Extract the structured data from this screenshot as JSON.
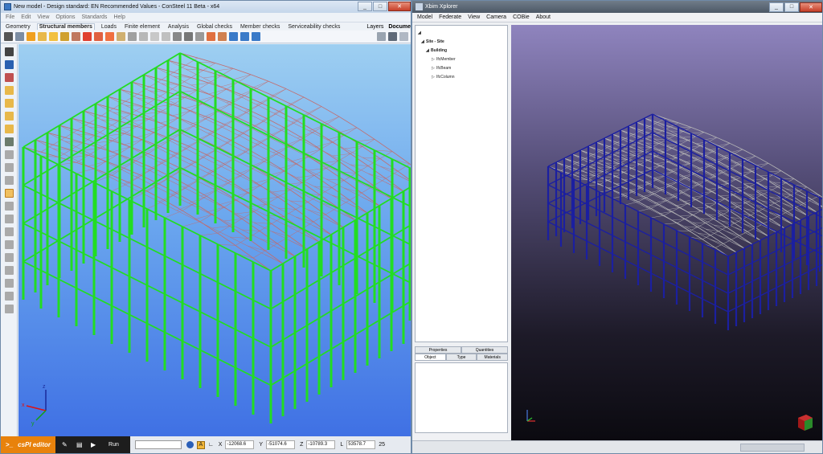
{
  "consteel": {
    "title": "New model - Design standard: EN Recommended Values - ConSteel 11 Beta - x64",
    "menu": [
      "File",
      "Edit",
      "View",
      "Options",
      "Standards",
      "Help"
    ],
    "tabs": [
      {
        "label": "Geometry",
        "active": false
      },
      {
        "label": "Structural members",
        "active": true
      },
      {
        "label": "Loads",
        "active": false
      },
      {
        "label": "Finite element",
        "active": false
      },
      {
        "label": "Analysis",
        "active": false
      },
      {
        "label": "Global checks",
        "active": false
      },
      {
        "label": "Member checks",
        "active": false
      },
      {
        "label": "Serviceability checks",
        "active": false
      }
    ],
    "right_tabs": [
      "Layers",
      "Docume"
    ],
    "statusbar": {
      "editor_label": "csPI editor",
      "run_label": "Run",
      "x_label": "X",
      "x_value": "-12068.6",
      "y_label": "Y",
      "y_value": "-51074.6",
      "z_label": "Z",
      "z_value": "-10789.3",
      "l_label": "L",
      "l_value": "53578.7",
      "snap_glyph": "A",
      "trailing": "25"
    },
    "axis": {
      "x": "x",
      "y": "y",
      "z": "z"
    },
    "colors": {
      "columns": "#22dd22",
      "trusses": "#c46a6a",
      "background_top": "#9ecff1",
      "background_bottom": "#3f70e4"
    }
  },
  "xbim": {
    "title": "Xbim Xplorer",
    "menu": [
      "Model",
      "Federate",
      "View",
      "Camera",
      "COBie",
      "About"
    ],
    "tree": [
      {
        "label": "",
        "level": 0,
        "bold": true
      },
      {
        "label": "Site - Site",
        "level": 1,
        "bold": true
      },
      {
        "label": "Building",
        "level": 2,
        "bold": true
      },
      {
        "label": "IfcMember",
        "level": 3,
        "bold": false
      },
      {
        "label": "IfcBeam",
        "level": 3,
        "bold": false
      },
      {
        "label": "IfcColumn",
        "level": 3,
        "bold": false
      }
    ],
    "props_tabs_top": [
      "Properties",
      "Quantities"
    ],
    "props_tabs_bottom": [
      "Object",
      "Type",
      "Materials"
    ],
    "colors": {
      "columns": "#1b1fa0",
      "trusses": "#b8b8b8"
    }
  }
}
